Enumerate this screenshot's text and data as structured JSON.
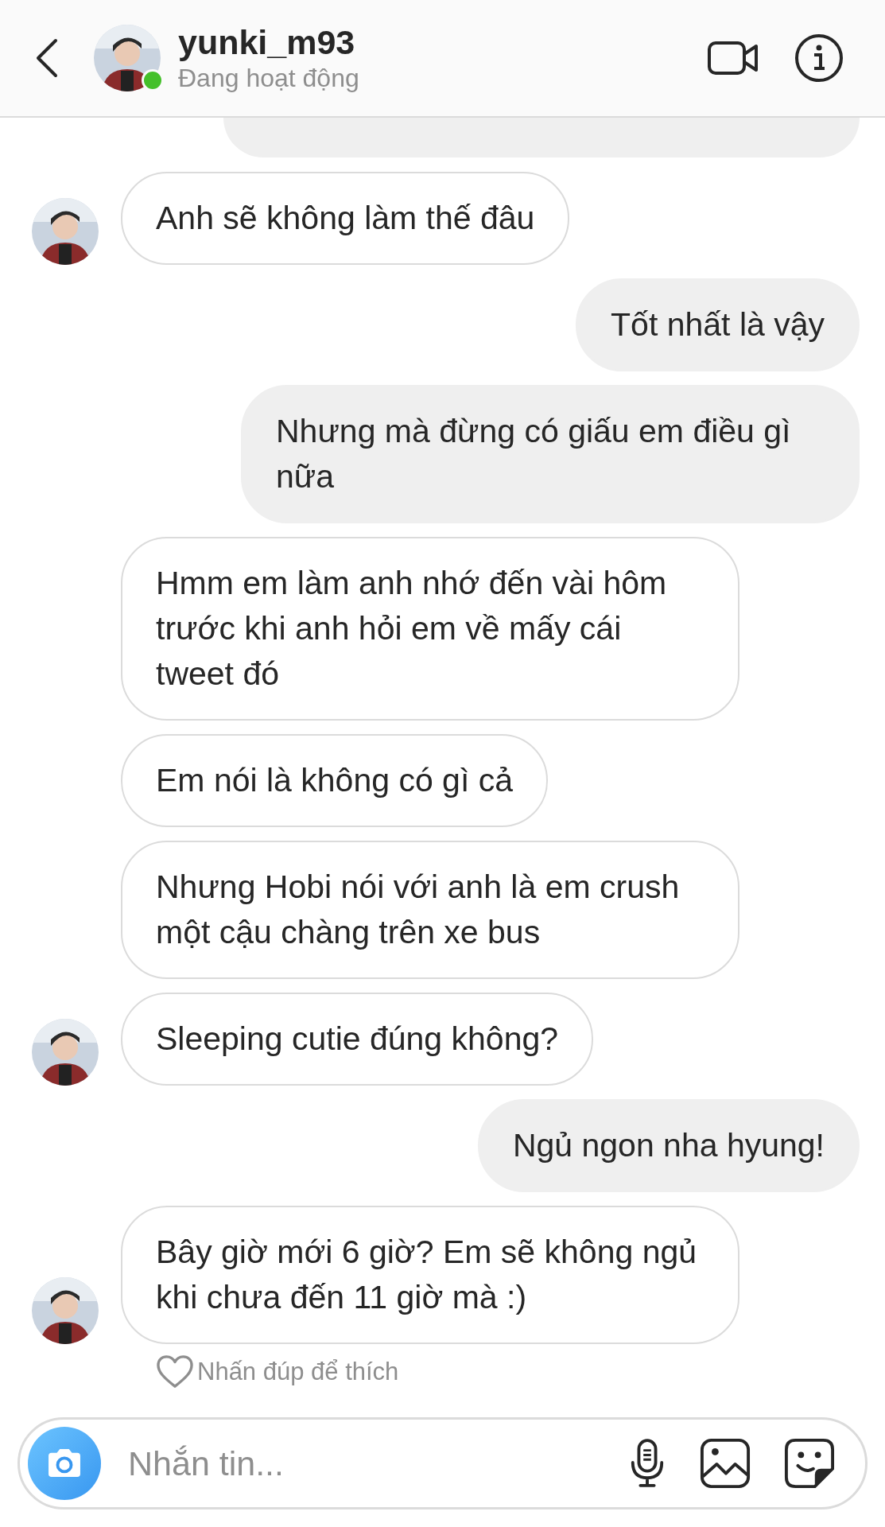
{
  "header": {
    "username": "yunki_m93",
    "status": "Đang hoạt động",
    "online": true
  },
  "messages": [
    {
      "kind": "received",
      "text": "Anh sẽ không làm thế đâu",
      "avatar": true
    },
    {
      "kind": "sent",
      "text": "Tốt nhất là vậy"
    },
    {
      "kind": "sent",
      "text": "Nhưng mà đừng có giấu em điều gì nữa"
    },
    {
      "kind": "received",
      "text": "Hmm em làm anh nhớ đến vài hôm trước khi anh hỏi em về mấy cái tweet đó",
      "avatar": false
    },
    {
      "kind": "received",
      "text": "Em nói là không có gì cả",
      "avatar": false
    },
    {
      "kind": "received",
      "text": "Nhưng Hobi nói với anh là em crush một cậu chàng trên xe bus",
      "avatar": false
    },
    {
      "kind": "received",
      "text": "Sleeping cutie đúng không?",
      "avatar": true
    },
    {
      "kind": "sent",
      "text": "Ngủ ngon nha hyung!"
    },
    {
      "kind": "received",
      "text": "Bây giờ mới 6 giờ? Em sẽ không ngủ khi chưa đến 11 giờ mà :)",
      "avatar": true
    }
  ],
  "like_hint": "Nhấn đúp để thích",
  "composer": {
    "placeholder": "Nhắn tin..."
  }
}
